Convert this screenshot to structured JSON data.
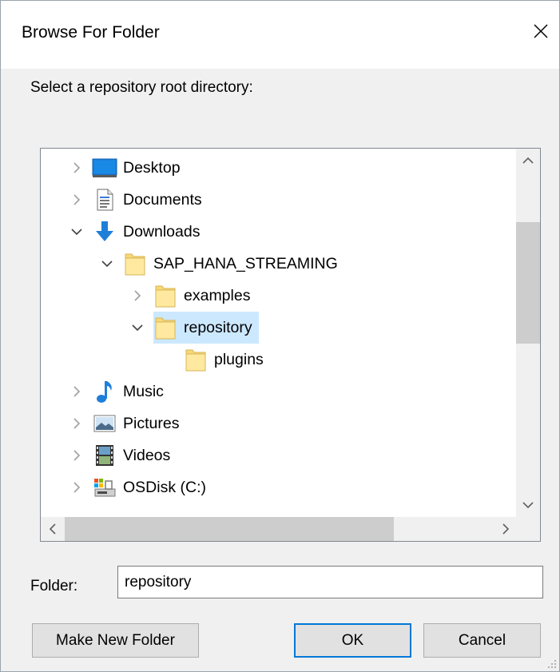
{
  "dialog": {
    "title": "Browse For Folder",
    "prompt": "Select a repository root directory:"
  },
  "tree": {
    "items": [
      {
        "label": "Desktop",
        "icon": "desktop-icon",
        "expander": "collapsed"
      },
      {
        "label": "Documents",
        "icon": "documents-icon",
        "expander": "collapsed"
      },
      {
        "label": "Downloads",
        "icon": "downloads-icon",
        "expander": "expanded"
      },
      {
        "label": "SAP_HANA_STREAMING",
        "icon": "folder-icon",
        "expander": "expanded"
      },
      {
        "label": "examples",
        "icon": "folder-icon",
        "expander": "collapsed"
      },
      {
        "label": "repository",
        "icon": "folder-icon",
        "expander": "expanded",
        "selected": true
      },
      {
        "label": "plugins",
        "icon": "folder-icon",
        "expander": "none"
      },
      {
        "label": "Music",
        "icon": "music-icon",
        "expander": "collapsed"
      },
      {
        "label": "Pictures",
        "icon": "pictures-icon",
        "expander": "collapsed"
      },
      {
        "label": "Videos",
        "icon": "videos-icon",
        "expander": "collapsed"
      },
      {
        "label": "OSDisk (C:)",
        "icon": "drive-icon",
        "expander": "collapsed"
      }
    ]
  },
  "folder_field": {
    "label": "Folder:",
    "value": "repository"
  },
  "buttons": {
    "make_new_folder": "Make New Folder",
    "ok": "OK",
    "cancel": "Cancel"
  },
  "colors": {
    "selection": "#cce8ff",
    "default_button_border": "#0078d7",
    "folder_yellow": "#f8d775",
    "download_blue": "#1e7fd9"
  }
}
